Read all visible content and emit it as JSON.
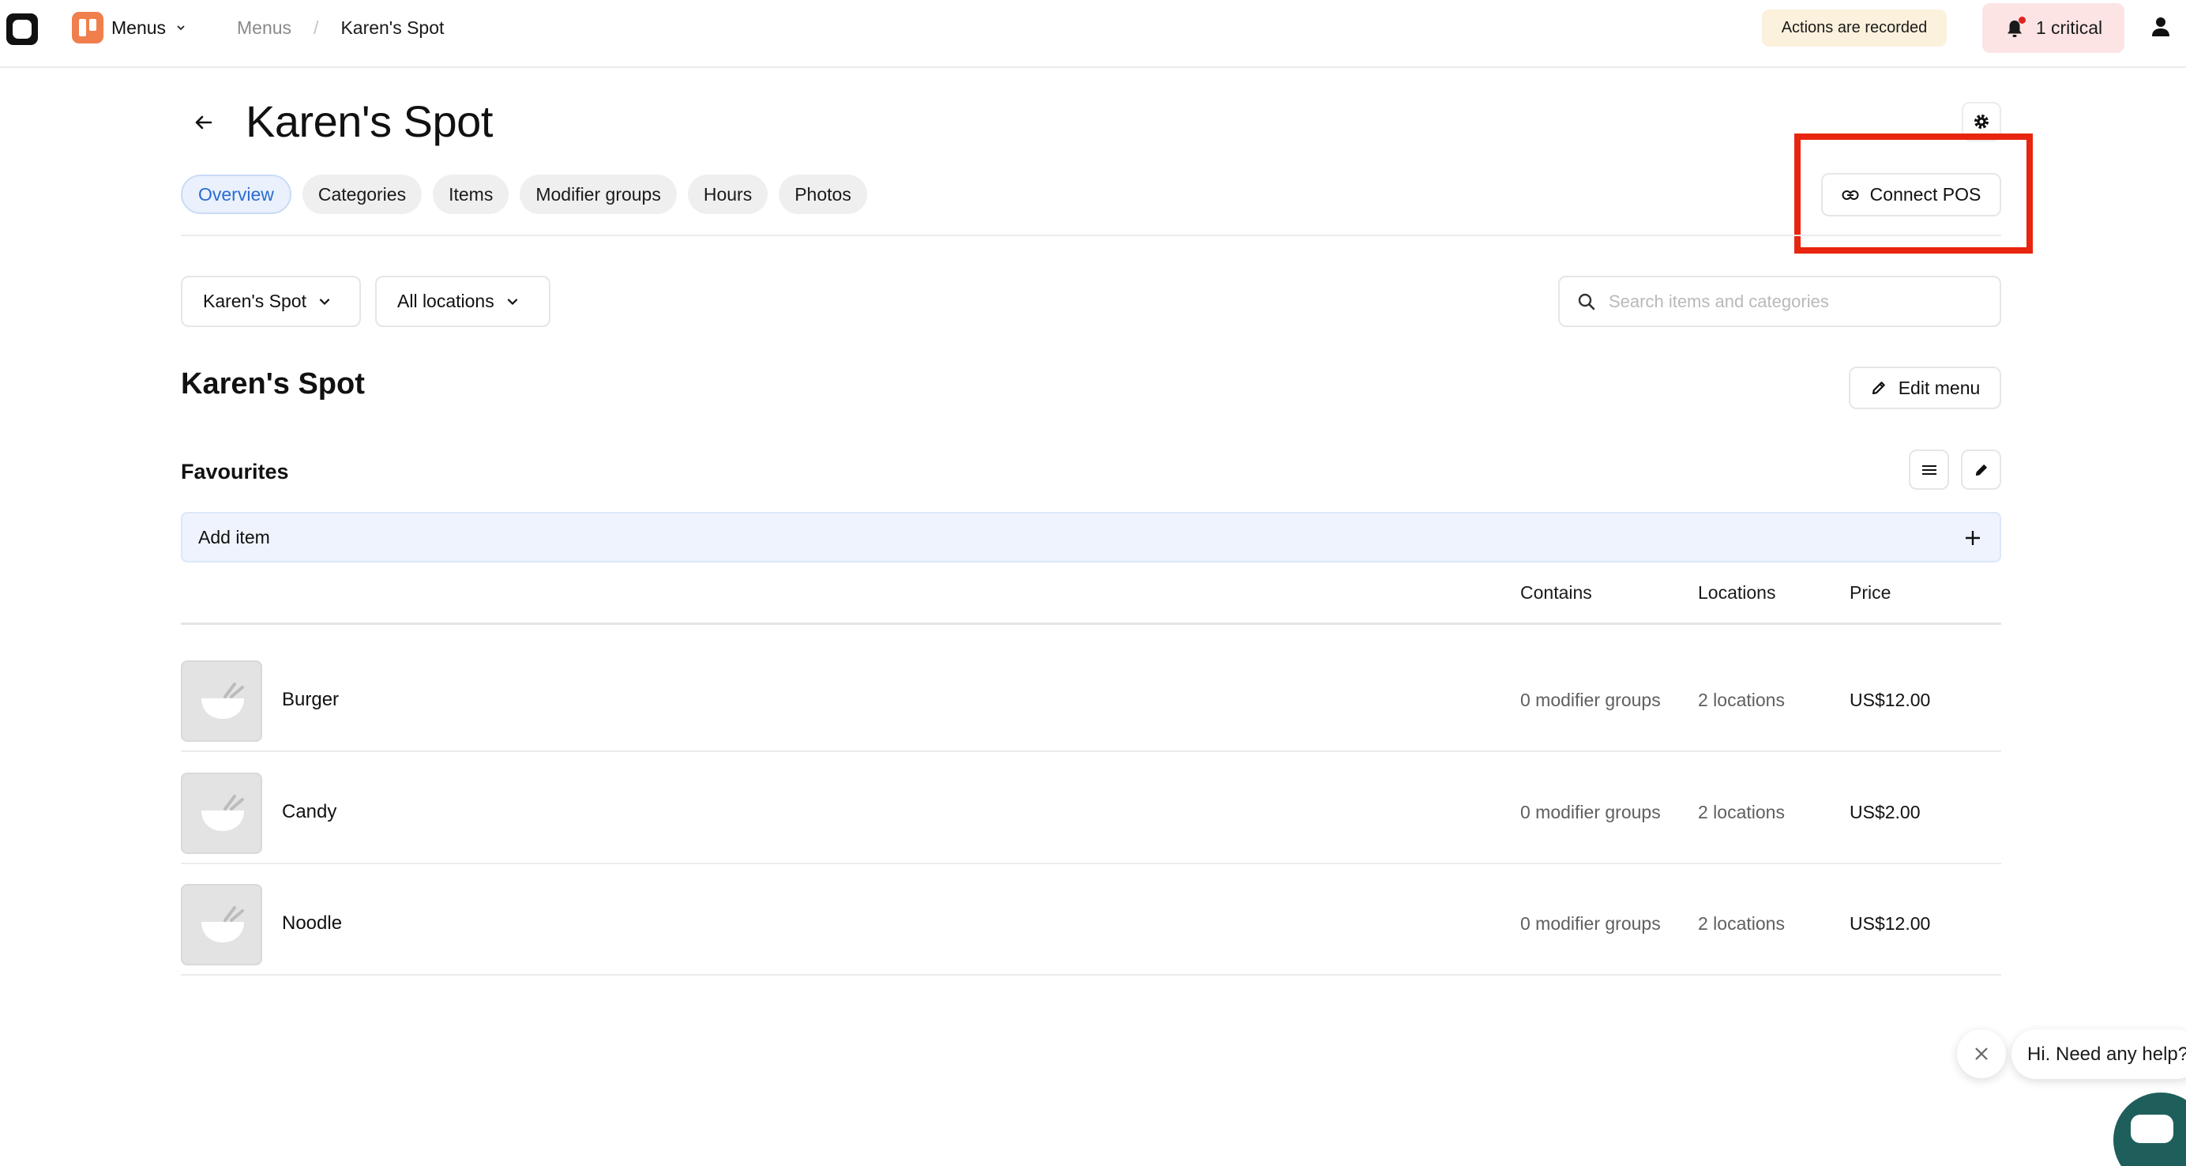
{
  "topbar": {
    "app_switcher_label": "Menus",
    "breadcrumb_root": "Menus",
    "breadcrumb_separator": "/",
    "breadcrumb_current": "Karen's Spot",
    "recorded_badge": "Actions are recorded",
    "alerts_label": "1 critical"
  },
  "header": {
    "title": "Karen's Spot"
  },
  "tabs": [
    {
      "label": "Overview",
      "active": true
    },
    {
      "label": "Categories",
      "active": false
    },
    {
      "label": "Items",
      "active": false
    },
    {
      "label": "Modifier groups",
      "active": false
    },
    {
      "label": "Hours",
      "active": false
    },
    {
      "label": "Photos",
      "active": false
    }
  ],
  "connect_pos_label": "Connect POS",
  "filters": {
    "location_select": "Karen's Spot",
    "locations_select": "All locations",
    "search_placeholder": "Search items and categories",
    "search_value": ""
  },
  "menu": {
    "title": "Karen's Spot",
    "edit_label": "Edit menu",
    "category": "Favourites",
    "add_item_label": "Add item",
    "columns": {
      "contains": "Contains",
      "locations": "Locations",
      "price": "Price"
    },
    "items": [
      {
        "name": "Burger",
        "contains": "0 modifier groups",
        "locations": "2 locations",
        "price": "US$12.00"
      },
      {
        "name": "Candy",
        "contains": "0 modifier groups",
        "locations": "2 locations",
        "price": "US$2.00"
      },
      {
        "name": "Noodle",
        "contains": "0 modifier groups",
        "locations": "2 locations",
        "price": "US$12.00"
      }
    ]
  },
  "chat": {
    "greeting": "Hi. Need any help?"
  },
  "colors": {
    "accent_blue": "#2a6bd1",
    "highlight_red": "#e8250e",
    "menus_orange": "#f07f4d",
    "chat_teal": "#1f5f5b",
    "critical_bg": "#fce4e4",
    "recorded_bg": "#fbf1dd"
  },
  "icons": {
    "back": "arrow-left-icon",
    "settings": "gear-icon",
    "connect": "link-icon",
    "search": "search-icon",
    "edit": "pencil-icon",
    "reorder": "list-icon",
    "add": "plus-icon",
    "bell": "bell-icon",
    "user": "user-icon",
    "thumb": "bowl-placeholder-icon"
  }
}
